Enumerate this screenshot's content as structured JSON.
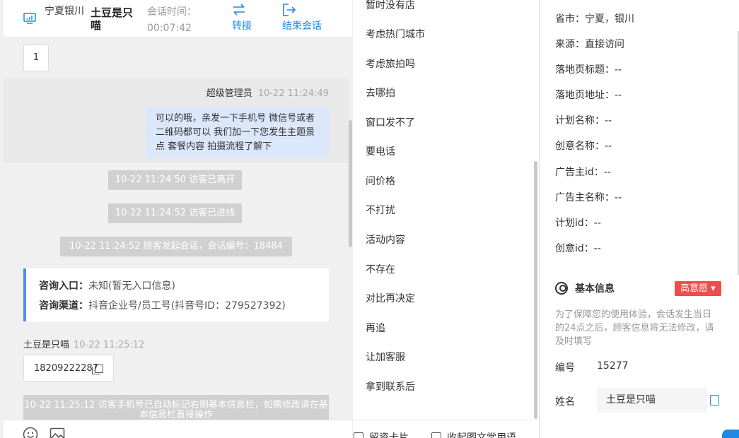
{
  "header": {
    "city": "宁夏银川",
    "visitor_name": "土豆是只喵",
    "session_time_label": "会话时间：",
    "session_time_value": "00:07:42",
    "transfer_label": "转接",
    "end_label": "结束会话"
  },
  "chat": {
    "page_number": "1",
    "agent_message": {
      "sender": "超级管理员",
      "time": "10-22 11:24:49",
      "text": "可以的哦，亲发一下手机号 微信号或者二维码都可以 我们加一下您发生主题景点 套餐内容 拍摄流程了解下"
    },
    "system_1": "10-22 11:24:50 访客已离开",
    "system_2": "10-22 11:24:52 访客已进线",
    "system_3": "10-22 11:24:52 顾客发起会话，会话编号：18484",
    "entry_label": "咨询入口：",
    "entry_value": "未知(暂无入口信息)",
    "channel_label": "咨询渠道：",
    "channel_value": "抖音企业号/员工号(抖音号ID：279527392)",
    "visitor_message": {
      "sender": "土豆是只喵",
      "time": "10-22 11:25:12",
      "text": "18209222287"
    },
    "system_4": "10-22 11:25:12 访客手机号已自动标记右侧基本信息栏，如需修改请在基本信息栏直接操作"
  },
  "phrases": [
    "暂时没有店",
    "考虑热门城市",
    "考虑旅拍吗",
    "去哪拍",
    "窗口发不了",
    "要电话",
    "问价格",
    "不打扰",
    "活动内容",
    "不存在",
    "对比再决定",
    "再追",
    "让加客服",
    "拿到联系后"
  ],
  "phrases_footer": {
    "card_label": "留资卡片",
    "collapse_label": "收起图文常用语"
  },
  "visitor_info": {
    "province_city": "省市：宁夏，银川",
    "source": "来源：直接访问",
    "landing_title": "落地页标题：--",
    "landing_url": "落地页地址：--",
    "plan_name": "计划名称：--",
    "creative_name": "创意名称：--",
    "advertiser_id": "广告主id：--",
    "advertiser_name": "广告主名称：--",
    "plan_id": "计划id：--",
    "creative_id": "创意id：--"
  },
  "basic_info": {
    "title": "基本信息",
    "intent": "高意愿",
    "notice": "为了保障您的使用体验，会话发生当日的24点之后，顾客信息将无法修改，请及时填写",
    "id_label": "编号",
    "id_value": "15277",
    "name_label": "姓名",
    "name_value": "土豆是只喵"
  },
  "colors": {
    "accent": "#1e88e5",
    "intent_red": "#ee4d4d",
    "agent_bubble": "#dbe7fb",
    "system_gray": "#d0d0d0"
  }
}
